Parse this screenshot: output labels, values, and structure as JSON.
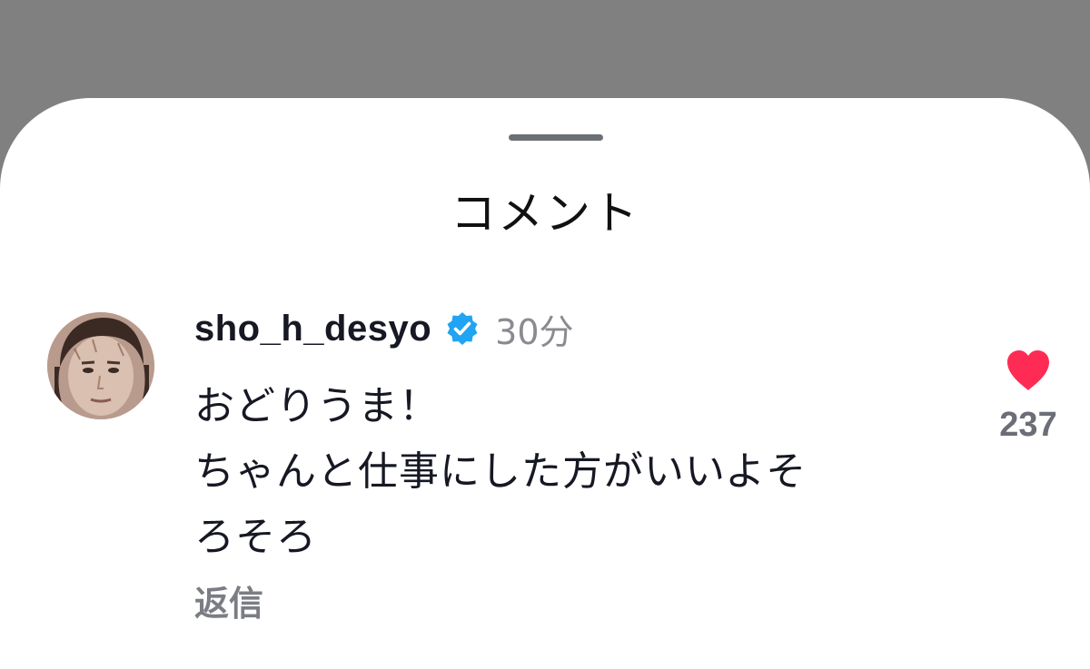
{
  "sheet": {
    "title": "コメント"
  },
  "comment": {
    "username": "sho_h_desyo",
    "verified": true,
    "time": "30分",
    "lines": [
      "おどりうま！",
      "ちゃんと仕事にした方がいいよそ",
      "ろそろ"
    ],
    "reply_label": "返信",
    "likes": "237",
    "liked": true
  },
  "colors": {
    "overlay": "#808080",
    "heart": "#fe2c55",
    "verified_badge": "#20a4f3",
    "muted_text": "#8a8b91"
  },
  "icons": {
    "verified": "verified-badge-icon",
    "like": "heart-icon",
    "handle": "drag-handle"
  }
}
